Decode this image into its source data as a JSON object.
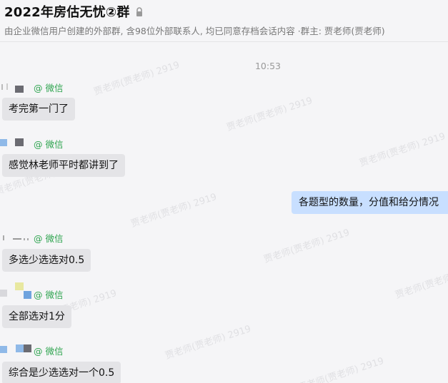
{
  "header": {
    "title": "2022年房估无忧②群",
    "subtitle": "由企业微信用户创建的外部群, 含98位外部联系人, 均已同意存档会话内容 ·群主: 贾老师(贾老师)"
  },
  "chat": {
    "timestamp": "10:53",
    "watermark": "贾老师(贾老师) 2919",
    "messages": [
      {
        "sender": "@ 微信",
        "text": "考完第一门了"
      },
      {
        "sender": "@ 微信",
        "text": "感觉林老师平时都讲到了"
      },
      {
        "self": true,
        "text": "各题型的数量，分值和给分情况"
      },
      {
        "sender": "@ 微信",
        "text": "多选少选选对0.5"
      },
      {
        "sender": "@ 微信",
        "text": "全部选对1分"
      },
      {
        "sender": "@ 微信",
        "text": "综合是少选选对一个0.5"
      }
    ]
  },
  "colors": {
    "background": "#f5f5f7",
    "incoming_bubble": "#e4e4e7",
    "outgoing_bubble": "#c8dfff",
    "sender_name": "#2ea44f"
  }
}
